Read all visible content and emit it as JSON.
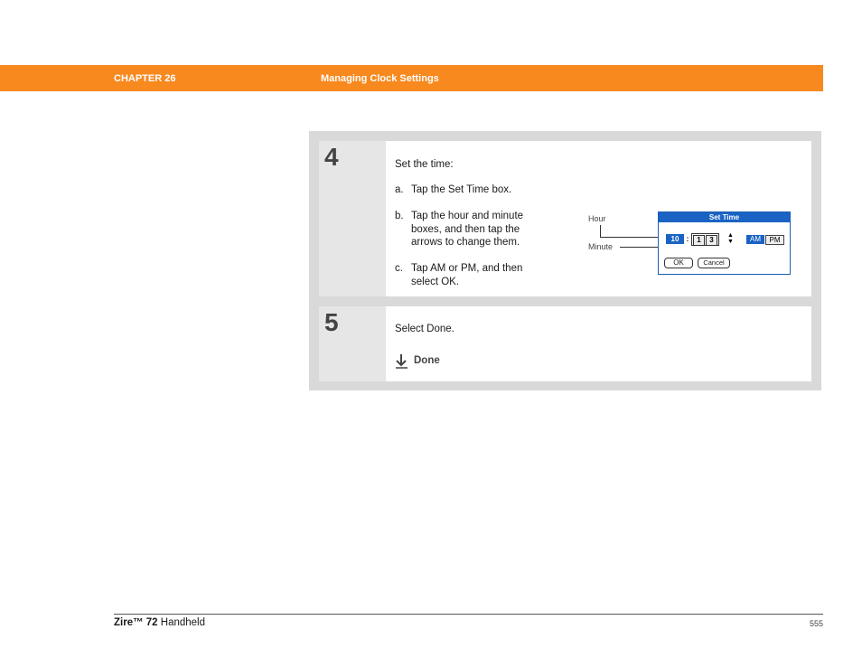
{
  "header": {
    "chapter": "CHAPTER 26",
    "title": "Managing Clock Settings",
    "color": "#f7891f"
  },
  "steps": [
    {
      "number": "4",
      "intro": "Set the time:",
      "substeps": [
        {
          "label": "a.",
          "text": "Tap the Set Time box."
        },
        {
          "label": "b.",
          "text": "Tap the hour and minute boxes, and then tap the arrows to change them."
        },
        {
          "label": "c.",
          "text": "Tap AM or PM, and then select OK."
        }
      ],
      "figure": {
        "callouts": {
          "hour": "Hour",
          "minute": "Minute"
        },
        "dialog": {
          "title": "Set Time",
          "hour": "10",
          "colon": ":",
          "minute_digits": [
            "1",
            "3"
          ],
          "am": "AM",
          "pm": "PM",
          "ok": "OK",
          "cancel": "Cancel"
        }
      }
    },
    {
      "number": "5",
      "intro": "Select Done.",
      "done_label": "Done",
      "done_icon": "down-arrow-icon"
    }
  ],
  "footer": {
    "product_bold": "Zire™ 72",
    "product_rest": " Handheld",
    "page": "555"
  }
}
